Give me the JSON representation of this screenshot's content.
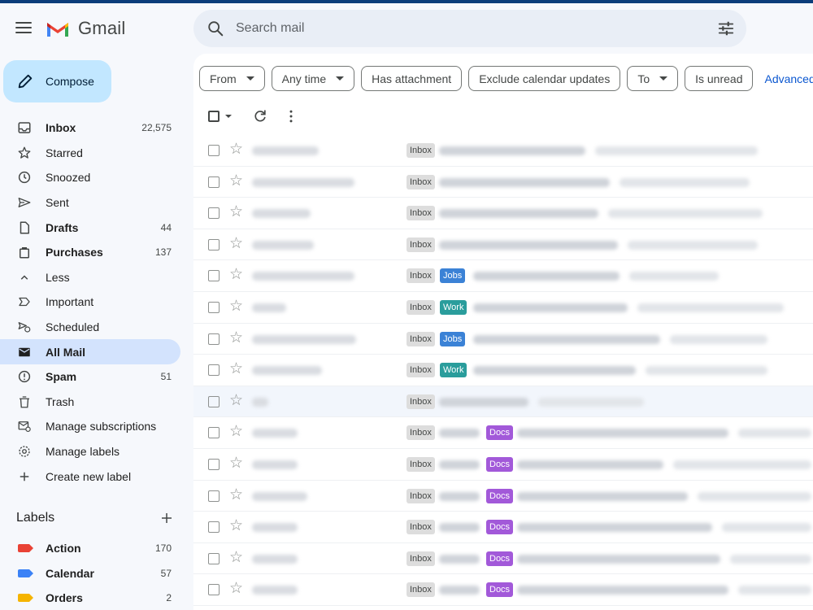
{
  "header": {
    "app_name": "Gmail",
    "search_placeholder": "Search mail"
  },
  "compose_label": "Compose",
  "nav": [
    {
      "label": "Inbox",
      "count": "22,575",
      "bold": true,
      "icon": "inbox-icon"
    },
    {
      "label": "Starred",
      "count": "",
      "bold": false,
      "icon": "star-icon"
    },
    {
      "label": "Snoozed",
      "count": "",
      "bold": false,
      "icon": "clock-icon"
    },
    {
      "label": "Sent",
      "count": "",
      "bold": false,
      "icon": "send-icon"
    },
    {
      "label": "Drafts",
      "count": "44",
      "bold": true,
      "icon": "draft-icon"
    },
    {
      "label": "Purchases",
      "count": "137",
      "bold": true,
      "icon": "shopping-bag-icon"
    },
    {
      "label": "Less",
      "count": "",
      "bold": false,
      "icon": "chevron-up-icon"
    },
    {
      "label": "Important",
      "count": "",
      "bold": false,
      "icon": "important-icon"
    },
    {
      "label": "Scheduled",
      "count": "",
      "bold": false,
      "icon": "scheduled-send-icon"
    },
    {
      "label": "All Mail",
      "count": "",
      "bold": true,
      "icon": "all-mail-icon",
      "active": true
    },
    {
      "label": "Spam",
      "count": "51",
      "bold": true,
      "icon": "spam-icon"
    },
    {
      "label": "Trash",
      "count": "",
      "bold": false,
      "icon": "trash-icon"
    },
    {
      "label": "Manage subscriptions",
      "count": "",
      "bold": false,
      "icon": "subscriptions-icon"
    },
    {
      "label": "Manage labels",
      "count": "",
      "bold": false,
      "icon": "settings-icon"
    },
    {
      "label": "Create new label",
      "count": "",
      "bold": false,
      "icon": "plus-icon"
    }
  ],
  "labels_section": {
    "title": "Labels",
    "items": [
      {
        "label": "Action",
        "count": "170",
        "color": "#e94235"
      },
      {
        "label": "Calendar",
        "count": "57",
        "color": "#3b82f6"
      },
      {
        "label": "Orders",
        "count": "2",
        "color": "#f5b400"
      }
    ]
  },
  "filters": {
    "chips": [
      {
        "label": "From",
        "dropdown": true
      },
      {
        "label": "Any time",
        "dropdown": true
      },
      {
        "label": "Has attachment",
        "dropdown": false
      },
      {
        "label": "Exclude calendar updates",
        "dropdown": false
      },
      {
        "label": "To",
        "dropdown": true
      },
      {
        "label": "Is unread",
        "dropdown": false
      }
    ],
    "advanced_link": "Advanced search"
  },
  "colors": {
    "jobs": "#3b82d6",
    "work": "#2a9d9c",
    "docs": "#a259d9",
    "active_nav": "#d3e3fd",
    "compose_bg": "#c2e7ff"
  },
  "emails": [
    {
      "inbox": "Inbox",
      "tag": ""
    },
    {
      "inbox": "Inbox",
      "tag": ""
    },
    {
      "inbox": "Inbox",
      "tag": ""
    },
    {
      "inbox": "Inbox",
      "tag": ""
    },
    {
      "inbox": "Inbox",
      "tag": "Jobs"
    },
    {
      "inbox": "Inbox",
      "tag": "Work"
    },
    {
      "inbox": "Inbox",
      "tag": "Jobs"
    },
    {
      "inbox": "Inbox",
      "tag": "Work"
    },
    {
      "inbox": "Inbox",
      "tag": ""
    },
    {
      "inbox": "Inbox",
      "tag": "Docs"
    },
    {
      "inbox": "Inbox",
      "tag": "Docs"
    },
    {
      "inbox": "Inbox",
      "tag": "Docs"
    },
    {
      "inbox": "Inbox",
      "tag": "Docs"
    },
    {
      "inbox": "Inbox",
      "tag": "Docs"
    },
    {
      "inbox": "Inbox",
      "tag": "Docs"
    }
  ]
}
